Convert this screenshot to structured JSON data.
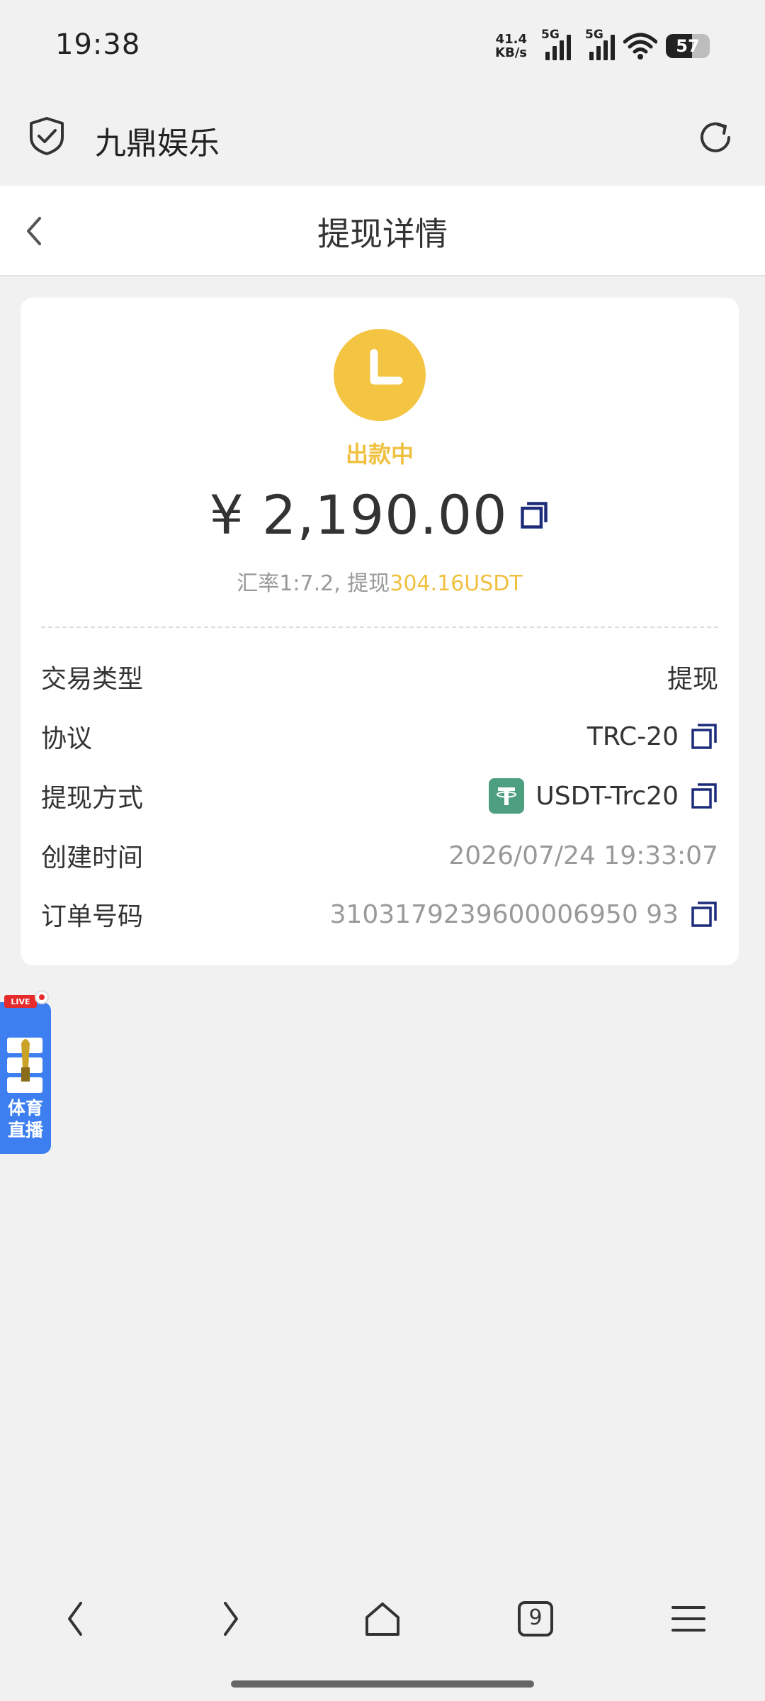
{
  "status_bar": {
    "time": "19:38",
    "net_speed_value": "41.4",
    "net_speed_unit": "KB/s",
    "signal_label_1": "5G",
    "signal_label_2": "5G",
    "battery": "57"
  },
  "browser": {
    "site_title": "九鼎娱乐",
    "shield_icon": "shield-check-icon",
    "reload_icon": "reload-icon"
  },
  "header": {
    "title": "提现详情",
    "back_icon": "chevron-left-icon"
  },
  "withdrawal": {
    "status": "出款中",
    "amount": "¥ 2,190.00",
    "rate_prefix": "汇率1:7.2, 提现",
    "rate_amount": "304.16USDT",
    "status_color": "#f4c542"
  },
  "details": [
    {
      "label": "交易类型",
      "value": "提现"
    },
    {
      "label": "协议",
      "value": "TRC-20"
    },
    {
      "label": "提现方式",
      "value": "USDT-Trc20"
    },
    {
      "label": "创建时间",
      "value": "2026/07/24 19:33:07"
    },
    {
      "label": "订单号码",
      "value": "3103179239600006950 93"
    }
  ],
  "live_widget": {
    "tag": "LIVE",
    "text_line1": "体育",
    "text_line2": "直播"
  },
  "bottom_nav": {
    "tabs_count": "9"
  }
}
